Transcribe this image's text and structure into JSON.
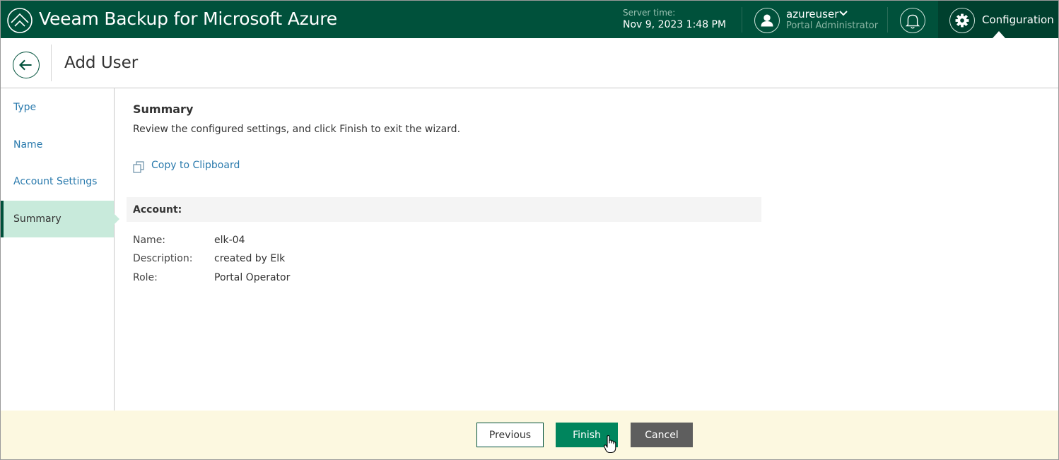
{
  "header": {
    "app_title": "Veeam Backup for Microsoft Azure",
    "server_time_label": "Server time:",
    "server_time_value": "Nov 9, 2023 1:48 PM",
    "user_name": "azureuser",
    "user_role": "Portal Administrator",
    "config_label": "Configuration"
  },
  "page": {
    "title": "Add User"
  },
  "wizard_steps": [
    {
      "label": "Type",
      "active": false
    },
    {
      "label": "Name",
      "active": false
    },
    {
      "label": "Account Settings",
      "active": false
    },
    {
      "label": "Summary",
      "active": true
    }
  ],
  "summary": {
    "title": "Summary",
    "description": "Review the configured settings, and click Finish to exit the wizard.",
    "copy_label": "Copy to Clipboard",
    "section_label": "Account:",
    "fields": [
      {
        "key": "Name:",
        "value": "elk-04"
      },
      {
        "key": "Description:",
        "value": "created by Elk"
      },
      {
        "key": "Role:",
        "value": "Portal Operator"
      }
    ]
  },
  "footer": {
    "previous_label": "Previous",
    "finish_label": "Finish",
    "cancel_label": "Cancel"
  },
  "colors": {
    "header_bg": "#00513b",
    "config_bg": "#00402e",
    "link": "#2a7aad",
    "active_step_bg": "#c8eadb",
    "finish_bg": "#00855d",
    "cancel_bg": "#5e5e5e",
    "footer_bg": "#fcf8e0"
  },
  "icons": [
    "veeam-logo-icon",
    "user-icon",
    "chevron-down-icon",
    "bell-icon",
    "gear-icon",
    "back-arrow-icon",
    "copy-icon",
    "hand-cursor-icon"
  ]
}
